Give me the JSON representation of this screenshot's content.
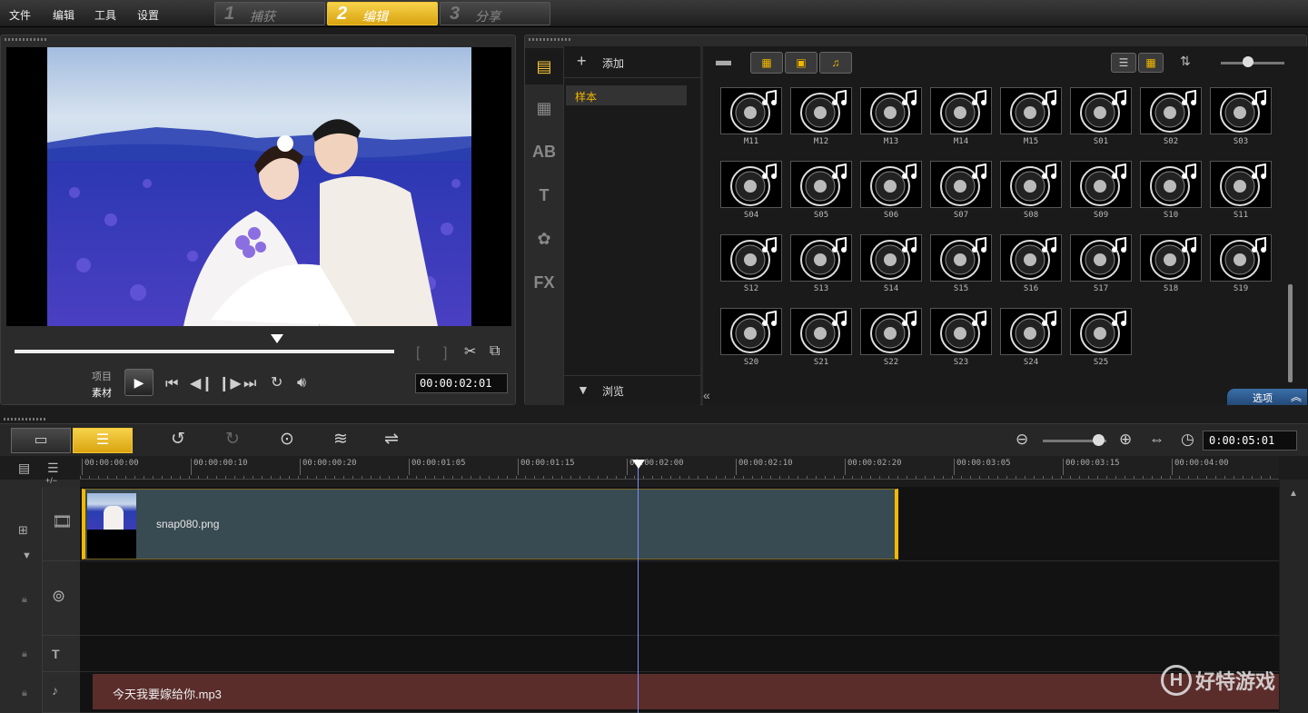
{
  "menu": [
    "文件",
    "编辑",
    "工具",
    "设置"
  ],
  "steps": [
    {
      "num": "1",
      "label": "捕获"
    },
    {
      "num": "2",
      "label": "编辑"
    },
    {
      "num": "3",
      "label": "分享"
    }
  ],
  "player": {
    "mode_project": "项目",
    "mode_clip": "素材",
    "timecode": "00:00:02:01",
    "scrub_position": 0.69
  },
  "library": {
    "add_label": "添加",
    "folder_selected": "样本",
    "browse_label": "浏览",
    "options_label": "选项",
    "items": [
      "M11",
      "M12",
      "M13",
      "M14",
      "M15",
      "S01",
      "S02",
      "S03",
      "S04",
      "S05",
      "S06",
      "S07",
      "S08",
      "S09",
      "S10",
      "S11",
      "S12",
      "S13",
      "S14",
      "S15",
      "S16",
      "S17",
      "S18",
      "S19",
      "S20",
      "S21",
      "S22",
      "S23",
      "S24",
      "S25"
    ]
  },
  "timeline": {
    "duration": "0:00:05:01",
    "ruler_ticks": [
      "00:00:00:00",
      "00:00:00:10",
      "00:00:00:20",
      "00:00:01:05",
      "00:00:01:15",
      "00:00:02:00",
      "00:00:02:10",
      "00:00:02:20",
      "00:00:03:05",
      "00:00:03:15",
      "00:00:04:00"
    ],
    "video_clip": "snap080.png",
    "audio_clip": "今天我要嫁给你.mp3",
    "add_remove": "+/−"
  },
  "watermark": "好特游戏",
  "colors": {
    "accent": "#f2b800",
    "audio": "#5a2d2b",
    "video": "#384a52",
    "playhead": "#7d8fff"
  }
}
